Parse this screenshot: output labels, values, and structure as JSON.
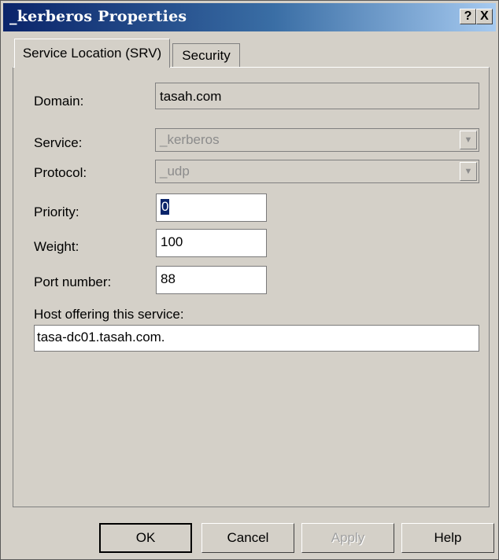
{
  "window": {
    "title": "_kerberos Properties",
    "help_button": "?",
    "close_button": "X"
  },
  "tabs": [
    {
      "label": "Service Location (SRV)",
      "active": true
    },
    {
      "label": "Security",
      "active": false
    }
  ],
  "form": {
    "domain": {
      "label": "Domain:",
      "value": "tasah.com"
    },
    "service": {
      "label": "Service:",
      "value": "_kerberos",
      "disabled": true
    },
    "protocol": {
      "label": "Protocol:",
      "value": "_udp",
      "disabled": true
    },
    "priority": {
      "label": "Priority:",
      "value": "0"
    },
    "weight": {
      "label": "Weight:",
      "value": "100"
    },
    "port": {
      "label": "Port number:",
      "value": "88"
    },
    "host": {
      "label": "Host offering this service:",
      "value": "tasa-dc01.tasah.com."
    }
  },
  "buttons": {
    "ok": "OK",
    "cancel": "Cancel",
    "apply": "Apply",
    "help": "Help"
  }
}
